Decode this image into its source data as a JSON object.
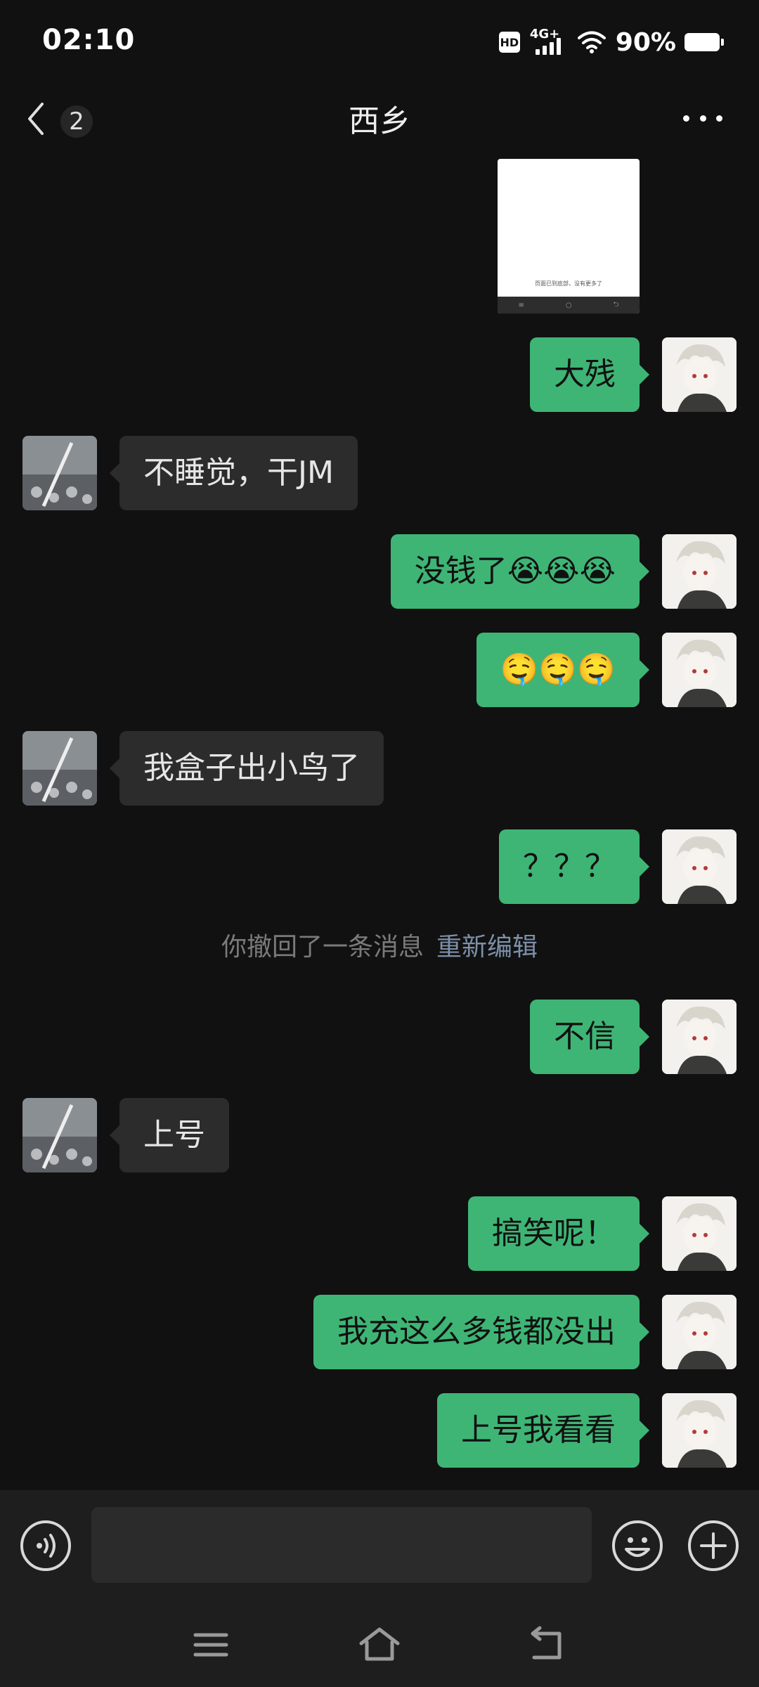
{
  "status_bar": {
    "time": "02:10",
    "hd_label": "HD",
    "network_label": "4G+",
    "battery_percent": "90%"
  },
  "header": {
    "back_unread_count": "2",
    "title": "西乡"
  },
  "messages": [
    {
      "type": "image",
      "direction": "out",
      "caption": "页面已到底部，没有更多了"
    },
    {
      "type": "text",
      "direction": "out",
      "text": "大残"
    },
    {
      "type": "text",
      "direction": "in",
      "text": "不睡觉，干JM"
    },
    {
      "type": "text",
      "direction": "out",
      "text": "没钱了😭😭😭"
    },
    {
      "type": "text",
      "direction": "out",
      "text": "🤤🤤🤤"
    },
    {
      "type": "text",
      "direction": "in",
      "text": "我盒子出小鸟了"
    },
    {
      "type": "text",
      "direction": "out",
      "text": "？？？"
    },
    {
      "type": "system",
      "text": "你撤回了一条消息",
      "action": "重新编辑"
    },
    {
      "type": "text",
      "direction": "out",
      "text": "不信"
    },
    {
      "type": "text",
      "direction": "in",
      "text": "上号"
    },
    {
      "type": "text",
      "direction": "out",
      "text": "搞笑呢！"
    },
    {
      "type": "text",
      "direction": "out",
      "text": "我充这么多钱都没出"
    },
    {
      "type": "text",
      "direction": "out",
      "text": "上号我看看"
    }
  ],
  "input_bar": {
    "text_value": "",
    "voice_icon": "voice-icon",
    "emoji_icon": "emoji-icon",
    "plus_icon": "plus-icon"
  },
  "nav_bar": {
    "menu_icon": "menu-icon",
    "home_icon": "home-icon",
    "back_icon": "back-icon"
  },
  "colors": {
    "background": "#111111",
    "outgoing_bubble": "#3eb575",
    "incoming_bubble": "#2c2c2c",
    "link": "#7d90a9"
  }
}
